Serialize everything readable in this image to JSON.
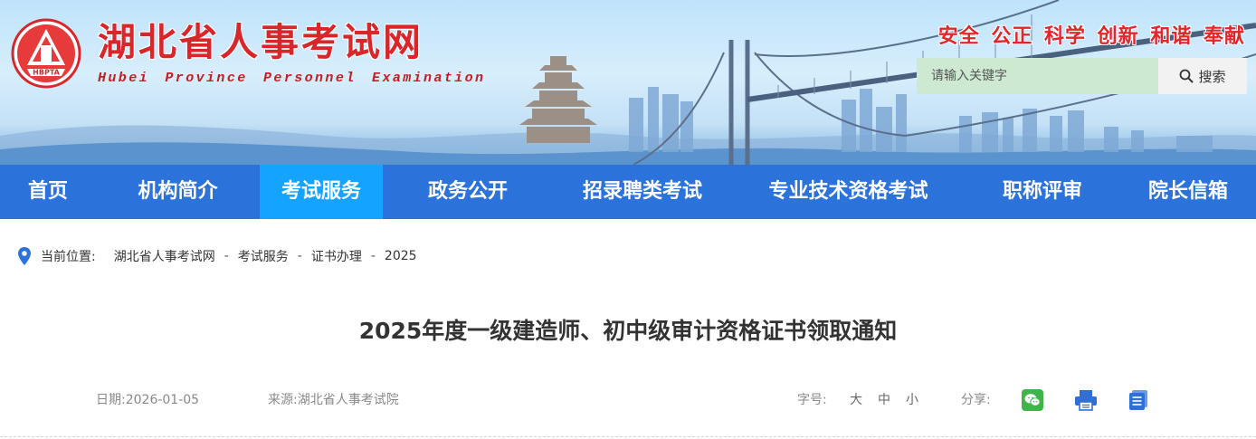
{
  "header": {
    "logo_badge": "HBPTA",
    "site_name_cn": "湖北省人事考试网",
    "site_name_en": "Hubei Province Personnel Examination",
    "slogan": "安全 公正 科学 创新 和谐 奉献",
    "search": {
      "placeholder": "请输入关键字",
      "button_label": "搜索"
    }
  },
  "nav": {
    "items": [
      "首页",
      "机构简介",
      "考试服务",
      "政务公开",
      "招录聘类考试",
      "专业技术资格考试",
      "职称评审",
      "院长信箱"
    ],
    "active_index": 2
  },
  "breadcrumb": {
    "label": "当前位置:",
    "items": [
      "湖北省人事考试网",
      "考试服务",
      "证书办理",
      "2025"
    ],
    "separator": "-"
  },
  "article": {
    "title": "2025年度一级建造师、初中级审计资格证书领取通知",
    "date_label": "日期:",
    "date": "2026-01-05",
    "source_label": "来源:",
    "source": "湖北省人事考试院",
    "font_size_label": "字号:",
    "font_sizes": [
      "大",
      "中",
      "小"
    ],
    "share_label": "分享:",
    "share_icons": [
      "wechat-icon",
      "print-icon",
      "copy-icon"
    ]
  },
  "colors": {
    "nav_bg": "#2b72da",
    "nav_active": "#14a4ff",
    "brand_red": "#d8262b",
    "search_bg": "#cde9d2",
    "wechat": "#3fb549",
    "icon_blue": "#2f6fd6"
  }
}
